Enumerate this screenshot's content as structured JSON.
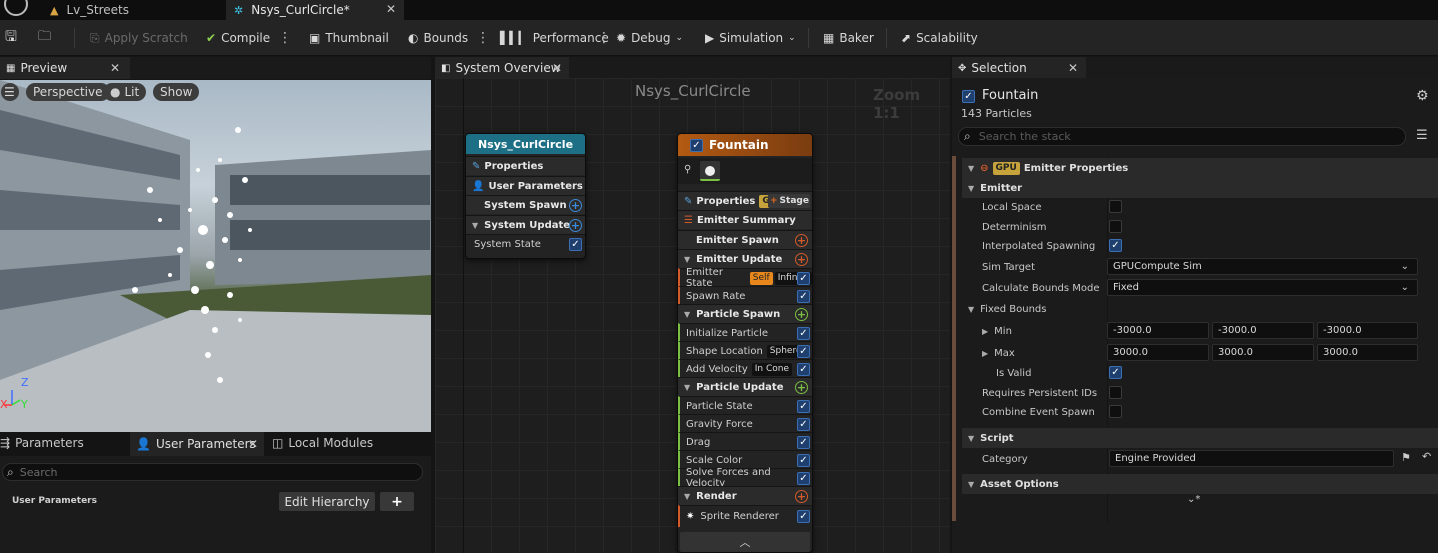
{
  "tabs": {
    "level": "Lv_Streets",
    "asset": "Nsys_CurlCircle*"
  },
  "toolbar": {
    "apply_scratch": "Apply Scratch",
    "compile": "Compile",
    "thumbnail": "Thumbnail",
    "bounds": "Bounds",
    "performance": "Performance",
    "debug": "Debug",
    "simulation": "Simulation",
    "baker": "Baker",
    "scalability": "Scalability"
  },
  "preview": {
    "tab": "Preview",
    "perspective": "Perspective",
    "lit": "Lit",
    "show": "Show",
    "axis_z": "Z",
    "axis_x": "X",
    "axis_y": "Y"
  },
  "params": {
    "tab_parameters": "Parameters",
    "tab_user_parameters": "User Parameters",
    "tab_local_modules": "Local Modules",
    "search_placeholder": "Search",
    "row_label": "User Parameters",
    "edit_hierarchy": "Edit Hierarchy",
    "add": "+"
  },
  "overview": {
    "tab": "System Overview",
    "title": "Nsys_CurlCircle",
    "zoom": "Zoom 1:1",
    "system_node": {
      "title": "Nsys_CurlCircle",
      "rows": [
        "Properties",
        "User Parameters",
        "System Spawn",
        "System Update",
        "System State"
      ]
    },
    "emitter_node": {
      "title": "Fountain",
      "properties": "Properties",
      "gpu": "GPU",
      "stage": "Stage",
      "summary": "Emitter Summary",
      "emitter_spawn": "Emitter Spawn",
      "emitter_update": "Emitter Update",
      "emitter_state": "Emitter State",
      "self_tag": "Self",
      "infinite_tag": "Infinite",
      "spawn_rate": "Spawn Rate",
      "particle_spawn": "Particle Spawn",
      "initialize_particle": "Initialize Particle",
      "shape_location": "Shape Location",
      "sphere_tag": "Sphere",
      "add_velocity": "Add Velocity",
      "in_cone_tag": "In Cone",
      "particle_update": "Particle Update",
      "particle_state": "Particle State",
      "gravity_force": "Gravity Force",
      "drag": "Drag",
      "scale_color": "Scale Color",
      "solve_forces": "Solve Forces and Velocity",
      "render": "Render",
      "sprite_renderer": "Sprite Renderer"
    }
  },
  "selection": {
    "tab": "Selection",
    "emitter_name": "Fountain",
    "particles": "143 Particles",
    "search_placeholder": "Search the stack",
    "gpu_badge": "GPU",
    "emitter_properties": "Emitter Properties",
    "emitter_cat": "Emitter",
    "local_space": "Local Space",
    "determinism": "Determinism",
    "interpolated_spawning": "Interpolated Spawning",
    "sim_target": "Sim Target",
    "sim_target_value": "GPUCompute Sim",
    "calc_bounds_mode": "Calculate Bounds Mode",
    "calc_bounds_value": "Fixed",
    "fixed_bounds": "Fixed Bounds",
    "min": "Min",
    "min_x": "-3000.0",
    "min_y": "-3000.0",
    "min_z": "-3000.0",
    "max": "Max",
    "max_x": "3000.0",
    "max_y": "3000.0",
    "max_z": "3000.0",
    "is_valid": "Is Valid",
    "requires_persistent_ids": "Requires Persistent IDs",
    "combine_event_spawn": "Combine Event Spawn",
    "script_cat": "Script",
    "category": "Category",
    "category_value": "Engine Provided",
    "asset_options": "Asset Options"
  },
  "colors": {
    "system_header": "#1d6f86",
    "emitter_header": "#b35a12",
    "check_blue": "#2d6fd1",
    "spawn_orange": "#d35a2a",
    "update_green": "#7bc043"
  }
}
